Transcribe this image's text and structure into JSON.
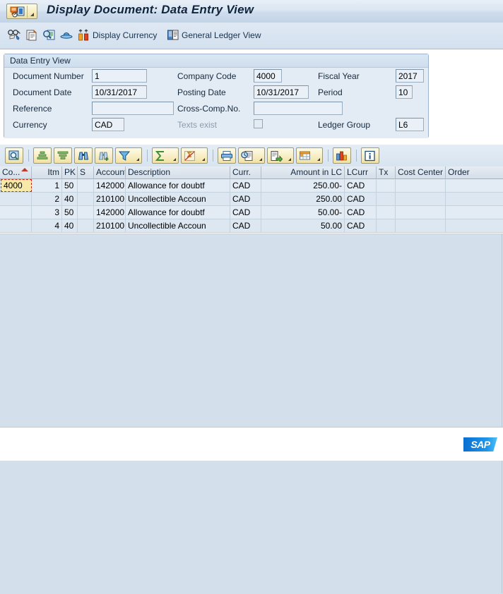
{
  "window": {
    "title": "Display Document: Data Entry View",
    "system_menu_icon": "document-menu-icon"
  },
  "app_toolbar": {
    "items": [
      {
        "label": "",
        "icon": "glasses-pencil-icon",
        "name": "display-change-button"
      },
      {
        "label": "",
        "icon": "copy-document-icon",
        "name": "other-document-button"
      },
      {
        "label": "",
        "icon": "magnifier-document-icon",
        "name": "display-document-header-button"
      },
      {
        "label": "",
        "icon": "hat-icon",
        "name": "document-overview-button"
      },
      {
        "label": "Display Currency",
        "icon": "currency-bars-icon",
        "name": "display-currency-button"
      },
      {
        "label": "General Ledger View",
        "icon": "ledger-view-icon",
        "name": "general-ledger-view-button"
      }
    ]
  },
  "data_entry_panel": {
    "title": "Data Entry View",
    "fields": [
      {
        "label": "Document Number",
        "value": "1",
        "name": "document-number"
      },
      {
        "label": "Company Code",
        "value": "4000",
        "name": "company-code"
      },
      {
        "label": "Fiscal Year",
        "value": "2017",
        "name": "fiscal-year"
      },
      {
        "label": "Document Date",
        "value": "10/31/2017",
        "name": "document-date"
      },
      {
        "label": "Posting Date",
        "value": "10/31/2017",
        "name": "posting-date"
      },
      {
        "label": "Period",
        "value": "10",
        "name": "period"
      },
      {
        "label": "Reference",
        "value": "",
        "name": "reference"
      },
      {
        "label": "Cross-Comp.No.",
        "value": "",
        "name": "cross-company-number"
      },
      {
        "label": "Currency",
        "value": "CAD",
        "name": "currency"
      },
      {
        "label": "Texts exist",
        "value": "",
        "name": "texts-exist",
        "checked": false,
        "disabled": true
      },
      {
        "label": "Ledger Group",
        "value": "L6",
        "name": "ledger-group"
      }
    ]
  },
  "grid_toolbar": {
    "buttons": [
      {
        "name": "detail-button",
        "icon": "magnifier-icon",
        "dropdown": false
      },
      {
        "name": "sort-ascending-button",
        "icon": "sort-ascending-icon",
        "dropdown": false
      },
      {
        "name": "sort-descending-button",
        "icon": "sort-descending-icon",
        "dropdown": false
      },
      {
        "name": "find-button",
        "icon": "binoculars-icon",
        "dropdown": false
      },
      {
        "name": "find-next-button",
        "icon": "binoculars-plus-icon",
        "dropdown": false
      },
      {
        "name": "set-filter-button",
        "icon": "filter-icon",
        "dropdown": true
      },
      {
        "name": "total-button",
        "icon": "sigma-icon",
        "dropdown": true
      },
      {
        "name": "subtotal-button",
        "icon": "subtotal-icon",
        "dropdown": true
      },
      {
        "name": "print-button",
        "icon": "printer-icon",
        "dropdown": false
      },
      {
        "name": "print-preview-button",
        "icon": "print-preview-icon",
        "dropdown": true
      },
      {
        "name": "export-button",
        "icon": "export-icon",
        "dropdown": true
      },
      {
        "name": "choose-layout-button",
        "icon": "layout-grid-icon",
        "dropdown": true
      },
      {
        "name": "graphic-button",
        "icon": "bar-chart-icon",
        "dropdown": false
      },
      {
        "name": "info-button",
        "icon": "info-icon",
        "dropdown": false
      }
    ]
  },
  "table": {
    "columns": [
      {
        "label": "Co...",
        "name": "company-code",
        "align": "left"
      },
      {
        "label": "Itm",
        "name": "item",
        "align": "right"
      },
      {
        "label": "PK",
        "name": "posting-key",
        "align": "left"
      },
      {
        "label": "S",
        "name": "special-gl-indicator",
        "align": "left"
      },
      {
        "label": "Account",
        "name": "account",
        "align": "left"
      },
      {
        "label": "Description",
        "name": "description",
        "align": "left"
      },
      {
        "label": "Curr.",
        "name": "currency",
        "align": "left"
      },
      {
        "label": "Amount in LC",
        "name": "amount-in-lc",
        "align": "right"
      },
      {
        "label": "LCurr",
        "name": "local-currency",
        "align": "left"
      },
      {
        "label": "Tx",
        "name": "tax-code",
        "align": "left"
      },
      {
        "label": "Cost Center",
        "name": "cost-center",
        "align": "left"
      },
      {
        "label": "Order",
        "name": "order",
        "align": "left"
      }
    ],
    "sorted_column": "Co...",
    "sort_direction": "ascending",
    "selected_cell": {
      "row": 0,
      "column": "Co...",
      "value": "4000"
    },
    "rows": [
      {
        "co": "4000",
        "itm": "1",
        "pk": "50",
        "s": "",
        "account": "142000",
        "description": "Allowance for doubtf",
        "curr": "CAD",
        "amount": "250.00-",
        "lcurr": "CAD",
        "tx": "",
        "cost_center": "",
        "order": ""
      },
      {
        "co": "",
        "itm": "2",
        "pk": "40",
        "s": "",
        "account": "210100",
        "description": "Uncollectible Accoun",
        "curr": "CAD",
        "amount": "250.00",
        "lcurr": "CAD",
        "tx": "",
        "cost_center": "",
        "order": ""
      },
      {
        "co": "",
        "itm": "3",
        "pk": "50",
        "s": "",
        "account": "142000",
        "description": "Allowance for doubtf",
        "curr": "CAD",
        "amount": "50.00-",
        "lcurr": "CAD",
        "tx": "",
        "cost_center": "",
        "order": ""
      },
      {
        "co": "",
        "itm": "4",
        "pk": "40",
        "s": "",
        "account": "210100",
        "description": "Uncollectible Accoun",
        "curr": "CAD",
        "amount": "50.00",
        "lcurr": "CAD",
        "tx": "",
        "cost_center": "",
        "order": ""
      }
    ]
  },
  "footer": {
    "logo_text": "SAP"
  },
  "colors": {
    "title_text": "#10243e",
    "panel_bg": "#e3ecf5",
    "row_even": "#e3ecf5",
    "row_odd": "#dde7f1",
    "selected_cell_bg": "#f7e9a8",
    "selection_border": "#cc2222",
    "sap_blue": "#0a6ed1"
  }
}
